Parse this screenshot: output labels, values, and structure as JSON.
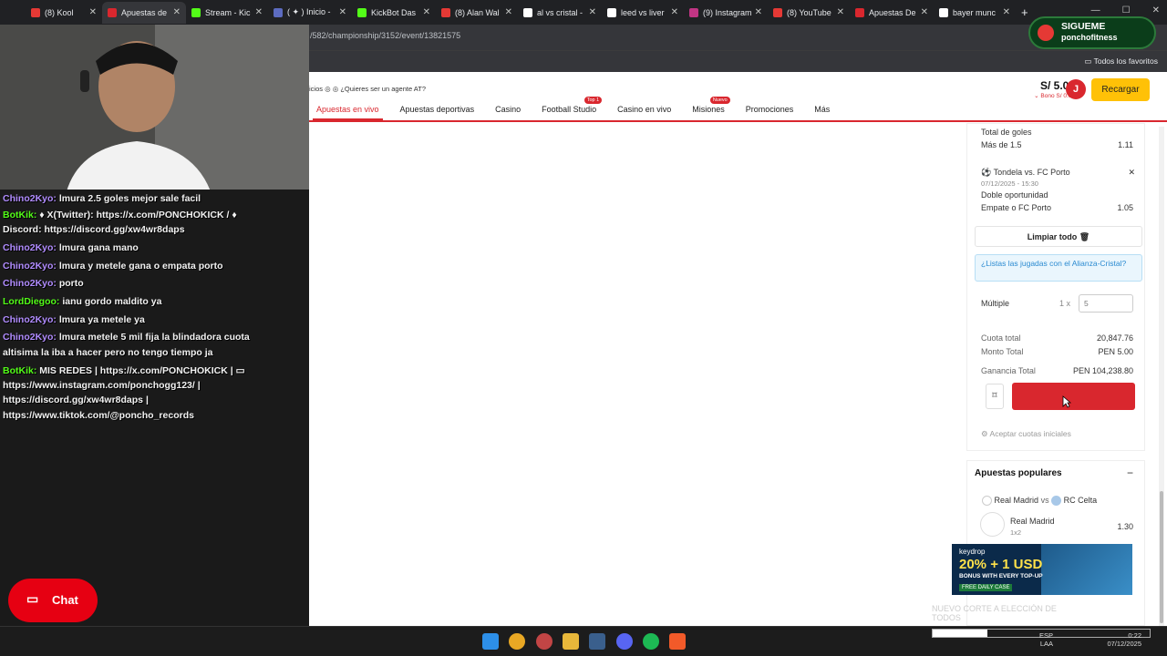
{
  "browser": {
    "tabs": [
      {
        "label": "(8) Kool",
        "color": "#e53935"
      },
      {
        "label": "Apuestas de",
        "color": "#d9272e"
      },
      {
        "label": "Stream - Kic",
        "color": "#53fc18"
      },
      {
        "label": "( ✦ ) Inicio -",
        "color": "#5c6bc0"
      },
      {
        "label": "KickBot Das",
        "color": "#53fc18"
      },
      {
        "label": "(8) Alan Wal",
        "color": "#e53935"
      },
      {
        "label": "al vs cristal -",
        "color": "#ffffff"
      },
      {
        "label": "leed vs liver",
        "color": "#ffffff"
      },
      {
        "label": "(9) Instagram",
        "color": "#c13584"
      },
      {
        "label": "(8) YouTube",
        "color": "#e53935"
      },
      {
        "label": "Apuestas De",
        "color": "#d9272e"
      },
      {
        "label": "bayer munc",
        "color": "#ffffff"
      }
    ],
    "url": "/582/championship/3152/event/13821575",
    "bookmarks_label": "Todos los favoritos"
  },
  "site": {
    "agent_text": "icios ◎ ◎   ¿Quieres ser un agente AT?",
    "nav": [
      {
        "label": "Apuestas en vivo",
        "active": true,
        "badge": ""
      },
      {
        "label": "Apuestas deportivas",
        "active": false,
        "badge": ""
      },
      {
        "label": "Casino",
        "active": false,
        "badge": ""
      },
      {
        "label": "Football Studio",
        "active": false,
        "badge": "Top 1"
      },
      {
        "label": "Casino en vivo",
        "active": false,
        "badge": ""
      },
      {
        "label": "Misiones",
        "active": false,
        "badge": "Nuevo"
      },
      {
        "label": "Promociones",
        "active": false,
        "badge": ""
      },
      {
        "label": "Más",
        "active": false,
        "badge": ""
      }
    ],
    "balance": "S/ 5.00",
    "bono": "⌄ Bono S/ 0.00",
    "avatar_letter": "J",
    "recargar": "Recargar"
  },
  "betslip": {
    "bet1_market": "Total de goles",
    "bet1_pick": "Más de 1.5",
    "bet1_odd": "1.11",
    "bet2_match": "Tondela vs. FC Porto",
    "bet2_date": "07/12/2025 - 15:30",
    "bet2_market": "Doble oportunidad",
    "bet2_pick": "Empate o FC Porto",
    "bet2_odd": "1.05",
    "limpiar": "Limpiar todo",
    "promo": "¿Listas las jugadas con el Alianza-Cristal?",
    "multiple_label": "Múltiple",
    "multiplier": "1 x",
    "stake": "5",
    "cuota_label": "Cuota total",
    "cuota_value": "20,847.76",
    "monto_label": "Monto Total",
    "monto_value": "PEN 5.00",
    "ganancia_label": "Ganancia Total",
    "ganancia_value": "PEN 104,238.80",
    "aceptar": "Aceptar cuotas iniciales"
  },
  "popular": {
    "title": "Apuestas populares",
    "home": "Real Madrid",
    "vs": "vs",
    "away": "RC Celta",
    "pick": "Real Madrid",
    "market": "1x2",
    "odd": "1.30",
    "market2": "1x2"
  },
  "chat": {
    "messages": [
      {
        "user": "Chino2Kyo:",
        "text": "lmura 2.5 goles mejor sale facil",
        "ucolor": "purple"
      },
      {
        "user": "BotKik:",
        "text": "♦ X(Twitter): https://x.com/PONCHOKICK / ♦",
        "ucolor": "green"
      },
      {
        "user": "",
        "text": "Discord: https://discord.gg/xw4wr8daps",
        "ucolor": ""
      },
      {
        "user": "Chino2Kyo:",
        "text": "lmura gana mano",
        "ucolor": "purple"
      },
      {
        "user": "Chino2Kyo:",
        "text": "lmura y metele gana o empata porto",
        "ucolor": "purple"
      },
      {
        "user": "Chino2Kyo:",
        "text": "porto",
        "ucolor": "purple"
      },
      {
        "user": "LordDiegoo:",
        "text": "ianu gordo maldito ya",
        "ucolor": "green"
      },
      {
        "user": "Chino2Kyo:",
        "text": "lmura ya metele ya",
        "ucolor": "purple"
      },
      {
        "user": "Chino2Kyo:",
        "text": "lmura metele 5 mil fija la blindadora cuota",
        "ucolor": "purple"
      },
      {
        "user": "",
        "text": "altisima la iba a hacer pero no tengo tiempo ja",
        "ucolor": ""
      },
      {
        "user": "BotKik:",
        "text": "MIS REDES | https://x.com/PONCHOKICK | ▭",
        "ucolor": "green"
      },
      {
        "user": "",
        "text": "https://www.instagram.com/ponchogg123/ |",
        "ucolor": ""
      },
      {
        "user": "",
        "text": "https://discord.gg/xw4wr8daps |",
        "ucolor": ""
      },
      {
        "user": "",
        "text": "https://www.tiktok.com/@poncho_records",
        "ucolor": ""
      }
    ],
    "button": "Chat"
  },
  "overlay": {
    "siguenos_line1": "SIGUEME",
    "siguenos_line2": "ponchofitness",
    "keydrop_brand": "keydrop",
    "keydrop_offer": "20% + 1 USD",
    "keydrop_sub": "BONUS WITH EVERY TOP-UP",
    "keydrop_case": "FREE DAILY CASE",
    "nuevo": "NUEVO CORTE A ELECCIÓN DE",
    "nuevo2": "TODOS"
  },
  "taskbar": {
    "lang": "ESP",
    "lang2": "LAA",
    "time": "0:22",
    "date": "07/12/2025"
  }
}
